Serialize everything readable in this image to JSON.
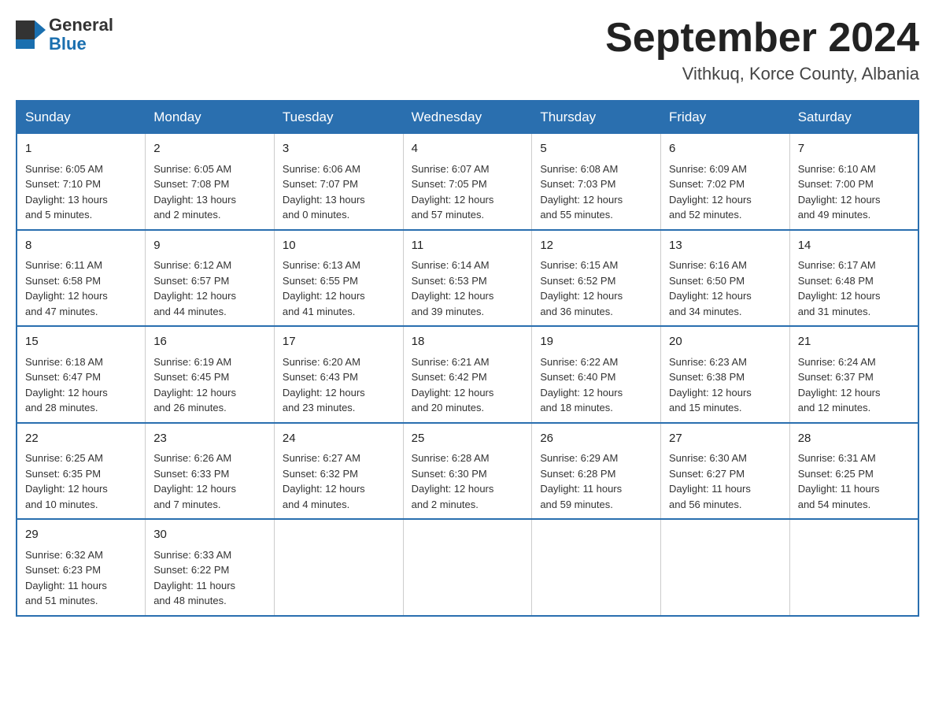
{
  "header": {
    "logo_general": "General",
    "logo_blue": "Blue",
    "month_title": "September 2024",
    "location": "Vithkuq, Korce County, Albania"
  },
  "days_of_week": [
    "Sunday",
    "Monday",
    "Tuesday",
    "Wednesday",
    "Thursday",
    "Friday",
    "Saturday"
  ],
  "weeks": [
    [
      {
        "day": "1",
        "sunrise": "6:05 AM",
        "sunset": "7:10 PM",
        "daylight": "13 hours and 5 minutes."
      },
      {
        "day": "2",
        "sunrise": "6:05 AM",
        "sunset": "7:08 PM",
        "daylight": "13 hours and 2 minutes."
      },
      {
        "day": "3",
        "sunrise": "6:06 AM",
        "sunset": "7:07 PM",
        "daylight": "13 hours and 0 minutes."
      },
      {
        "day": "4",
        "sunrise": "6:07 AM",
        "sunset": "7:05 PM",
        "daylight": "12 hours and 57 minutes."
      },
      {
        "day": "5",
        "sunrise": "6:08 AM",
        "sunset": "7:03 PM",
        "daylight": "12 hours and 55 minutes."
      },
      {
        "day": "6",
        "sunrise": "6:09 AM",
        "sunset": "7:02 PM",
        "daylight": "12 hours and 52 minutes."
      },
      {
        "day": "7",
        "sunrise": "6:10 AM",
        "sunset": "7:00 PM",
        "daylight": "12 hours and 49 minutes."
      }
    ],
    [
      {
        "day": "8",
        "sunrise": "6:11 AM",
        "sunset": "6:58 PM",
        "daylight": "12 hours and 47 minutes."
      },
      {
        "day": "9",
        "sunrise": "6:12 AM",
        "sunset": "6:57 PM",
        "daylight": "12 hours and 44 minutes."
      },
      {
        "day": "10",
        "sunrise": "6:13 AM",
        "sunset": "6:55 PM",
        "daylight": "12 hours and 41 minutes."
      },
      {
        "day": "11",
        "sunrise": "6:14 AM",
        "sunset": "6:53 PM",
        "daylight": "12 hours and 39 minutes."
      },
      {
        "day": "12",
        "sunrise": "6:15 AM",
        "sunset": "6:52 PM",
        "daylight": "12 hours and 36 minutes."
      },
      {
        "day": "13",
        "sunrise": "6:16 AM",
        "sunset": "6:50 PM",
        "daylight": "12 hours and 34 minutes."
      },
      {
        "day": "14",
        "sunrise": "6:17 AM",
        "sunset": "6:48 PM",
        "daylight": "12 hours and 31 minutes."
      }
    ],
    [
      {
        "day": "15",
        "sunrise": "6:18 AM",
        "sunset": "6:47 PM",
        "daylight": "12 hours and 28 minutes."
      },
      {
        "day": "16",
        "sunrise": "6:19 AM",
        "sunset": "6:45 PM",
        "daylight": "12 hours and 26 minutes."
      },
      {
        "day": "17",
        "sunrise": "6:20 AM",
        "sunset": "6:43 PM",
        "daylight": "12 hours and 23 minutes."
      },
      {
        "day": "18",
        "sunrise": "6:21 AM",
        "sunset": "6:42 PM",
        "daylight": "12 hours and 20 minutes."
      },
      {
        "day": "19",
        "sunrise": "6:22 AM",
        "sunset": "6:40 PM",
        "daylight": "12 hours and 18 minutes."
      },
      {
        "day": "20",
        "sunrise": "6:23 AM",
        "sunset": "6:38 PM",
        "daylight": "12 hours and 15 minutes."
      },
      {
        "day": "21",
        "sunrise": "6:24 AM",
        "sunset": "6:37 PM",
        "daylight": "12 hours and 12 minutes."
      }
    ],
    [
      {
        "day": "22",
        "sunrise": "6:25 AM",
        "sunset": "6:35 PM",
        "daylight": "12 hours and 10 minutes."
      },
      {
        "day": "23",
        "sunrise": "6:26 AM",
        "sunset": "6:33 PM",
        "daylight": "12 hours and 7 minutes."
      },
      {
        "day": "24",
        "sunrise": "6:27 AM",
        "sunset": "6:32 PM",
        "daylight": "12 hours and 4 minutes."
      },
      {
        "day": "25",
        "sunrise": "6:28 AM",
        "sunset": "6:30 PM",
        "daylight": "12 hours and 2 minutes."
      },
      {
        "day": "26",
        "sunrise": "6:29 AM",
        "sunset": "6:28 PM",
        "daylight": "11 hours and 59 minutes."
      },
      {
        "day": "27",
        "sunrise": "6:30 AM",
        "sunset": "6:27 PM",
        "daylight": "11 hours and 56 minutes."
      },
      {
        "day": "28",
        "sunrise": "6:31 AM",
        "sunset": "6:25 PM",
        "daylight": "11 hours and 54 minutes."
      }
    ],
    [
      {
        "day": "29",
        "sunrise": "6:32 AM",
        "sunset": "6:23 PM",
        "daylight": "11 hours and 51 minutes."
      },
      {
        "day": "30",
        "sunrise": "6:33 AM",
        "sunset": "6:22 PM",
        "daylight": "11 hours and 48 minutes."
      },
      null,
      null,
      null,
      null,
      null
    ]
  ],
  "labels": {
    "sunrise": "Sunrise:",
    "sunset": "Sunset:",
    "daylight": "Daylight:"
  }
}
